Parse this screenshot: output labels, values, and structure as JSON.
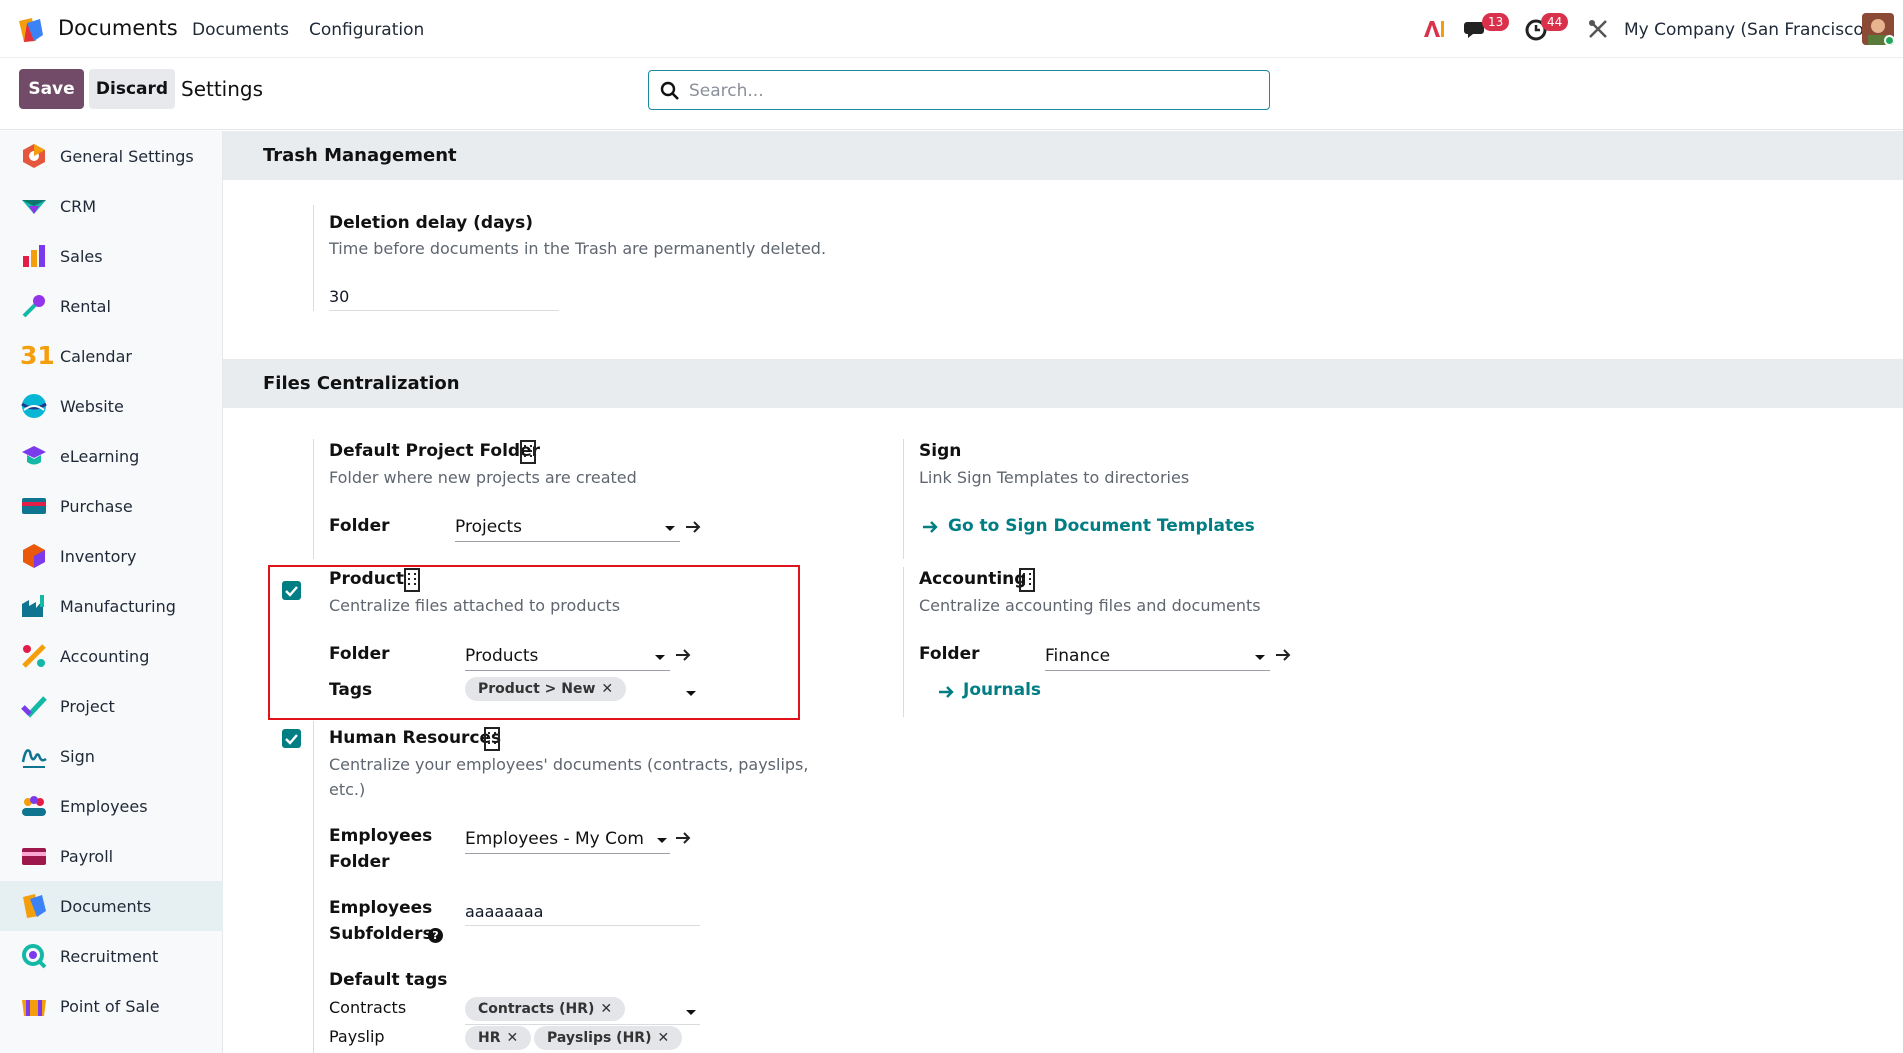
{
  "topbar": {
    "app_name": "Documents",
    "nav": [
      "Documents",
      "Configuration"
    ],
    "messages_count": "13",
    "activities_count": "44",
    "company": "My Company (San Francisco)"
  },
  "controlbar": {
    "save_label": "Save",
    "discard_label": "Discard",
    "breadcrumb": "Settings",
    "search_placeholder": "Search..."
  },
  "sidebar": {
    "items": [
      {
        "label": "General Settings",
        "icon": "general-settings-icon"
      },
      {
        "label": "CRM",
        "icon": "crm-icon"
      },
      {
        "label": "Sales",
        "icon": "sales-icon"
      },
      {
        "label": "Rental",
        "icon": "rental-icon"
      },
      {
        "label": "Calendar",
        "icon": "calendar-icon"
      },
      {
        "label": "Website",
        "icon": "website-icon"
      },
      {
        "label": "eLearning",
        "icon": "elearning-icon"
      },
      {
        "label": "Purchase",
        "icon": "purchase-icon"
      },
      {
        "label": "Inventory",
        "icon": "inventory-icon"
      },
      {
        "label": "Manufacturing",
        "icon": "manufacturing-icon"
      },
      {
        "label": "Accounting",
        "icon": "accounting-icon"
      },
      {
        "label": "Project",
        "icon": "project-icon"
      },
      {
        "label": "Sign",
        "icon": "sign-icon"
      },
      {
        "label": "Employees",
        "icon": "employees-icon"
      },
      {
        "label": "Payroll",
        "icon": "payroll-icon"
      },
      {
        "label": "Documents",
        "icon": "documents-icon",
        "active": true
      },
      {
        "label": "Recruitment",
        "icon": "recruitment-icon"
      },
      {
        "label": "Point of Sale",
        "icon": "point-of-sale-icon"
      }
    ],
    "calendar_glyph": "31"
  },
  "trash": {
    "title": "Trash Management",
    "setting_title": "Deletion delay (days)",
    "setting_desc": "Time before documents in the Trash are permanently deleted.",
    "value": "30"
  },
  "files": {
    "title": "Files Centralization",
    "default_project": {
      "title": "Default Project Folder",
      "desc": "Folder where new projects are created",
      "folder_label": "Folder",
      "folder_value": "Projects"
    },
    "sign": {
      "title": "Sign",
      "desc": "Link Sign Templates to directories",
      "link": "Go to Sign Document Templates"
    },
    "product": {
      "checked": true,
      "title": "Product",
      "desc": "Centralize files attached to products",
      "folder_label": "Folder",
      "folder_value": "Products",
      "tags_label": "Tags",
      "tags": [
        "Product > New"
      ]
    },
    "accounting": {
      "title": "Accounting",
      "desc": "Centralize accounting files and documents",
      "folder_label": "Folder",
      "folder_value": "Finance",
      "link": "Journals"
    },
    "hr": {
      "checked": true,
      "title": "Human Resources",
      "desc_line1": "Centralize your employees' documents (contracts, payslips,",
      "desc_line2": "etc.)",
      "emp_folder_label_1": "Employees",
      "emp_folder_label_2": "Folder",
      "emp_folder_value": "Employees - My Com…",
      "emp_sub_label_1": "Employees",
      "emp_sub_label_2": "Subfolders",
      "emp_sub_value": "aaaaaaaa",
      "help_glyph": "?",
      "default_tags_label": "Default tags",
      "contracts_label": "Contracts",
      "contracts_tags": [
        "Contracts (HR)"
      ],
      "payslip_label": "Payslip",
      "payslip_tags": [
        "HR",
        "Payslips (HR)"
      ]
    }
  },
  "tag_remove_glyph": "✕",
  "colors": {
    "primary": "#714b67",
    "accent": "#017e84",
    "highlight_border": "#e0131a",
    "badge": "#d9304b"
  }
}
